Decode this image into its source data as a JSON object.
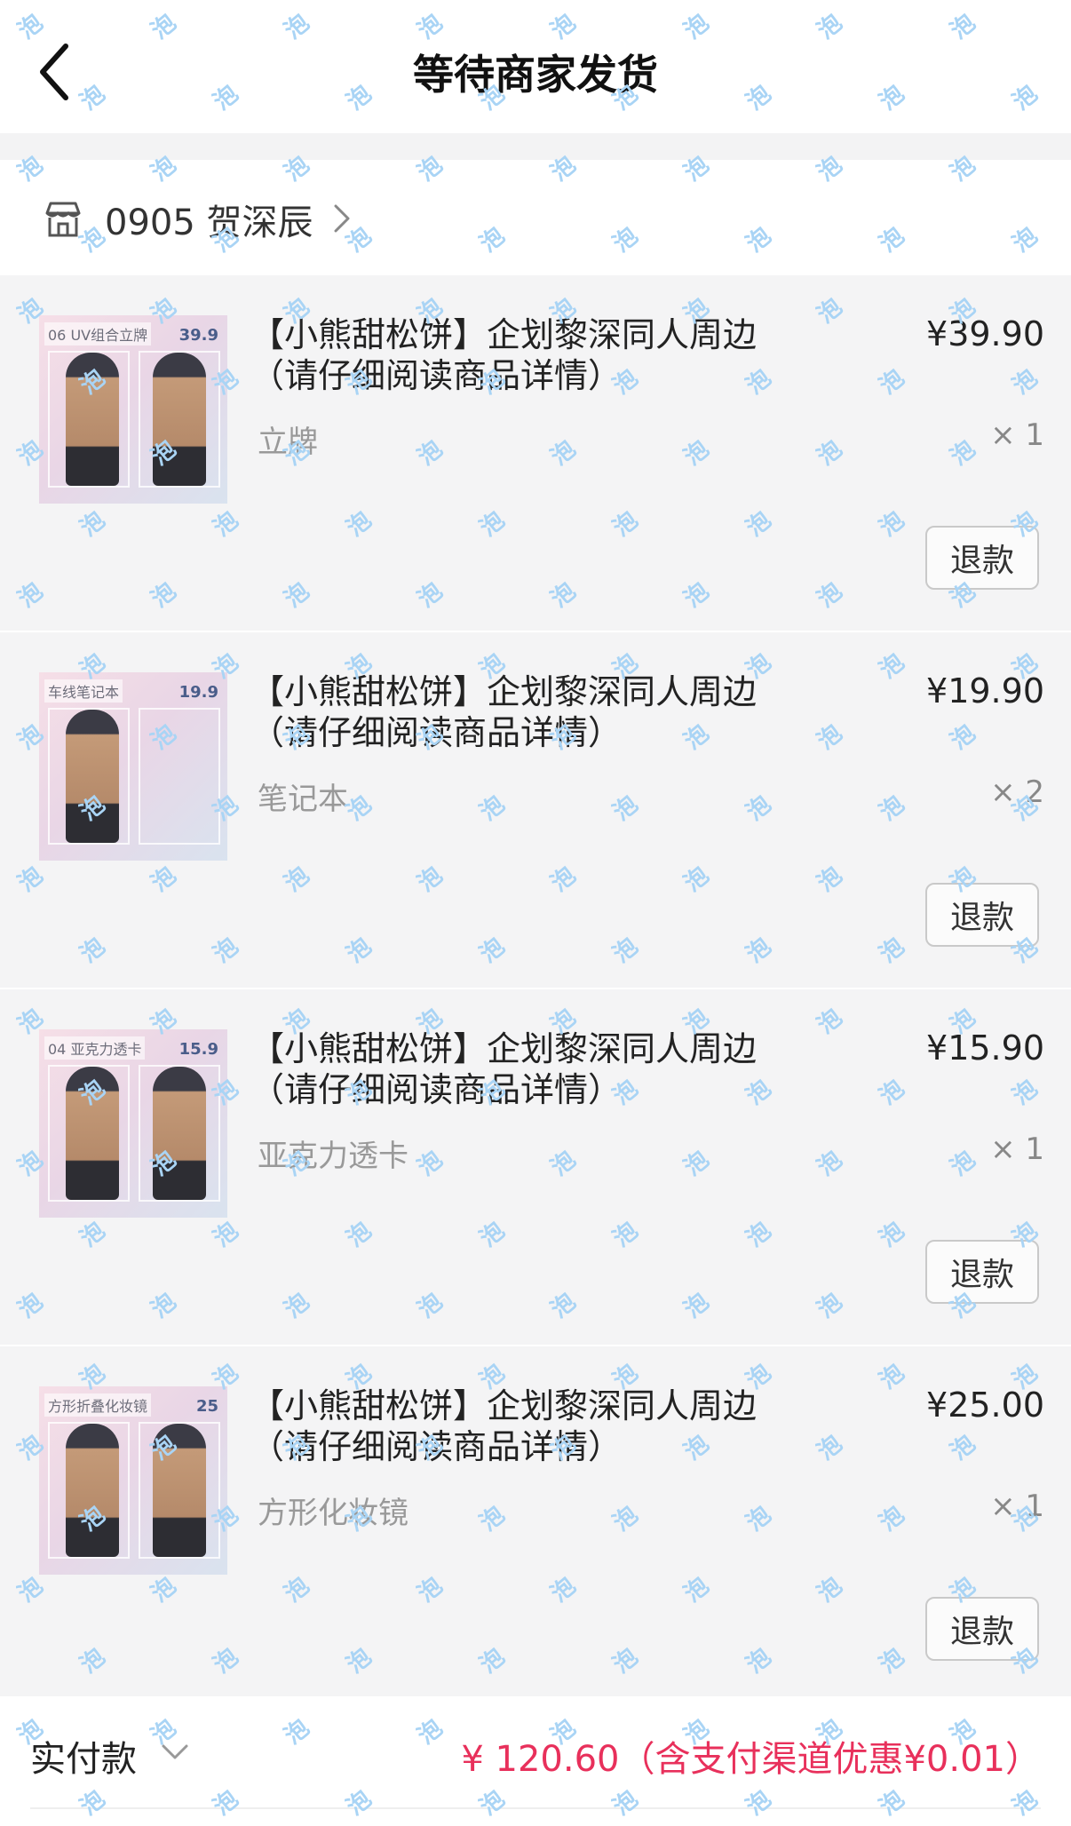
{
  "header": {
    "title": "等待商家发货"
  },
  "store": {
    "name": "0905 贺深辰"
  },
  "items": [
    {
      "title": "【小熊甜松饼】企划黎深同人周边（请仔细阅读商品详情）",
      "spec": "立牌",
      "price": "¥39.90",
      "qty": "× 1",
      "refund_label": "退款",
      "thumb_tag": "06 UV组合立牌",
      "thumb_price": "39.9"
    },
    {
      "title": "【小熊甜松饼】企划黎深同人周边（请仔细阅读商品详情）",
      "spec": "笔记本",
      "price": "¥19.90",
      "qty": "× 2",
      "refund_label": "退款",
      "thumb_tag": "车线笔记本",
      "thumb_price": "19.9"
    },
    {
      "title": "【小熊甜松饼】企划黎深同人周边（请仔细阅读商品详情）",
      "spec": "亚克力透卡",
      "price": "¥15.90",
      "qty": "× 1",
      "refund_label": "退款",
      "thumb_tag": "04 亚克力透卡",
      "thumb_price": "15.9"
    },
    {
      "title": "【小熊甜松饼】企划黎深同人周边（请仔细阅读商品详情）",
      "spec": "方形化妆镜",
      "price": "¥25.00",
      "qty": "× 1",
      "refund_label": "退款",
      "thumb_tag": "方形折叠化妆镜",
      "thumb_price": "25"
    }
  ],
  "payment": {
    "label": "实付款",
    "amount": "¥ 120.60（含支付渠道优惠¥0.01）"
  },
  "watermark": {
    "glyph": "泡"
  },
  "colors": {
    "accent_price": "#e8305b",
    "watermark": "#a9d4f5"
  }
}
